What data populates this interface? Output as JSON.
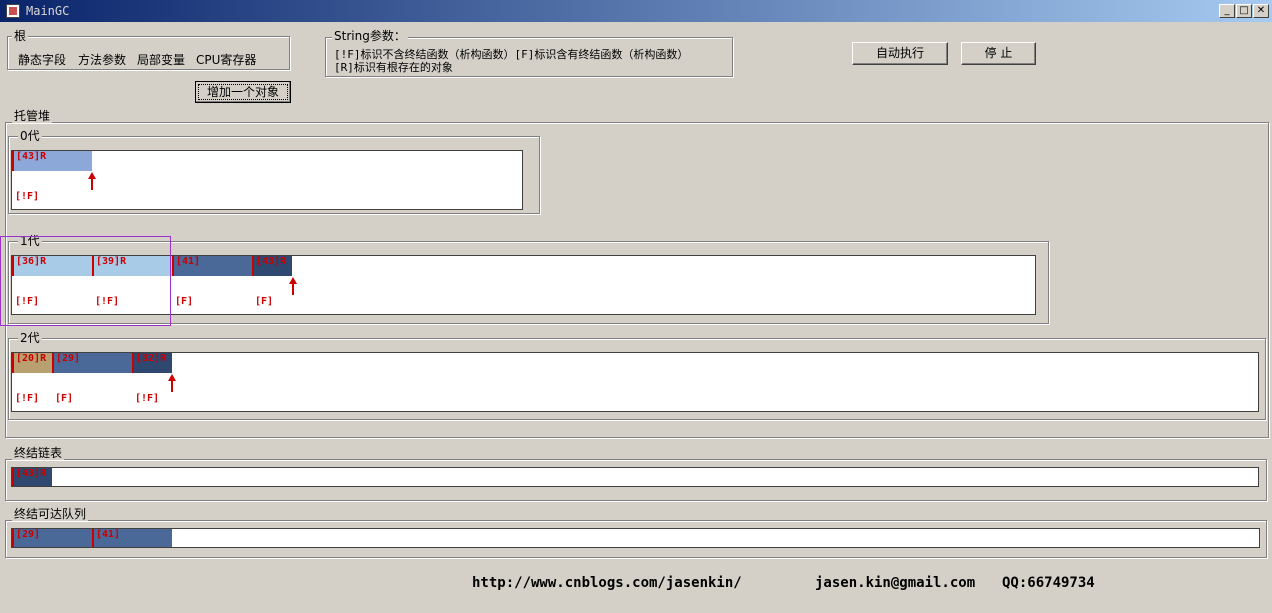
{
  "window": {
    "title": "MainGC",
    "min": "_",
    "max": "□",
    "close": "✕"
  },
  "roots": {
    "label": "根",
    "items": [
      "静态字段",
      "方法参数",
      "局部变量",
      "CPU寄存器"
    ]
  },
  "add_button": "增加一个对象",
  "string_params": {
    "label": "String参数：",
    "line1": "[!F]标识不含终结函数（析构函数）[F]标识含有终结函数（析构函数）",
    "line2": "[R]标识有根存在的对象"
  },
  "auto_button": "自动执行",
  "stop_button": "停  止",
  "heap": {
    "label": "托管堆",
    "gen0": {
      "label": "0代",
      "objects": [
        {
          "tag": "[43]R",
          "flag": "[!F]",
          "color": "#8ca8d8"
        }
      ]
    },
    "gen1": {
      "label": "1代",
      "objects": [
        {
          "tag": "[36]R",
          "flag": "[!F]",
          "color": "#a8cce8"
        },
        {
          "tag": "[39]R",
          "flag": "[!F]",
          "color": "#a8cce8"
        },
        {
          "tag": "[41]",
          "flag": "[F]",
          "color": "#4a6898"
        },
        {
          "tag": "[43]R",
          "flag": "[F]",
          "color": "#2e4870"
        }
      ]
    },
    "gen2": {
      "label": "2代",
      "objects": [
        {
          "tag": "[20]R",
          "flag": "[!F]",
          "color": "#b8a070"
        },
        {
          "tag": "[29]",
          "flag": "[F]",
          "color": "#4a6898"
        },
        {
          "tag": "[32]R",
          "flag": "[!F]",
          "color": "#2e4870"
        }
      ]
    }
  },
  "finalization": {
    "label": "终结链表",
    "objects": [
      {
        "tag": "[43]R",
        "color": "#2e4870"
      }
    ]
  },
  "freachable": {
    "label": "终结可达队列",
    "objects": [
      {
        "tag": "[29]",
        "color": "#4a6898"
      },
      {
        "tag": "[41]",
        "color": "#4a6898"
      }
    ]
  },
  "footer": {
    "url": "http://www.cnblogs.com/jasenkin/",
    "email": "jasen.kin@gmail.com",
    "qq": "QQ:66749734"
  }
}
